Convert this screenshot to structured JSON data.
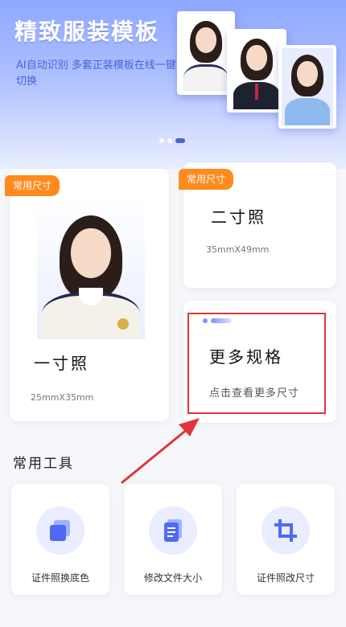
{
  "banner": {
    "title": "精致服装模板",
    "subtitle": "AI自动识别 多套正装模板在线一键切换",
    "carousel": {
      "count": 3,
      "active_index": 2
    }
  },
  "size_cards": [
    {
      "tag": "常用尺寸",
      "title": "一寸照",
      "size": "25mmX35mm"
    },
    {
      "tag": "常用尺寸",
      "title": "二寸照",
      "size": "35mmX49mm"
    }
  ],
  "more_card": {
    "title": "更多规格",
    "subtitle": "点击查看更多尺寸"
  },
  "tools": {
    "title": "常用工具",
    "items": [
      {
        "label": "证件照换底色",
        "icon": "layers-icon"
      },
      {
        "label": "修改文件大小",
        "icon": "document-icon"
      },
      {
        "label": "证件照改尺寸",
        "icon": "crop-icon"
      }
    ]
  },
  "colors": {
    "accent": "#4a63d6",
    "tag": "#ff8a1e",
    "highlight": "#e0363b"
  }
}
